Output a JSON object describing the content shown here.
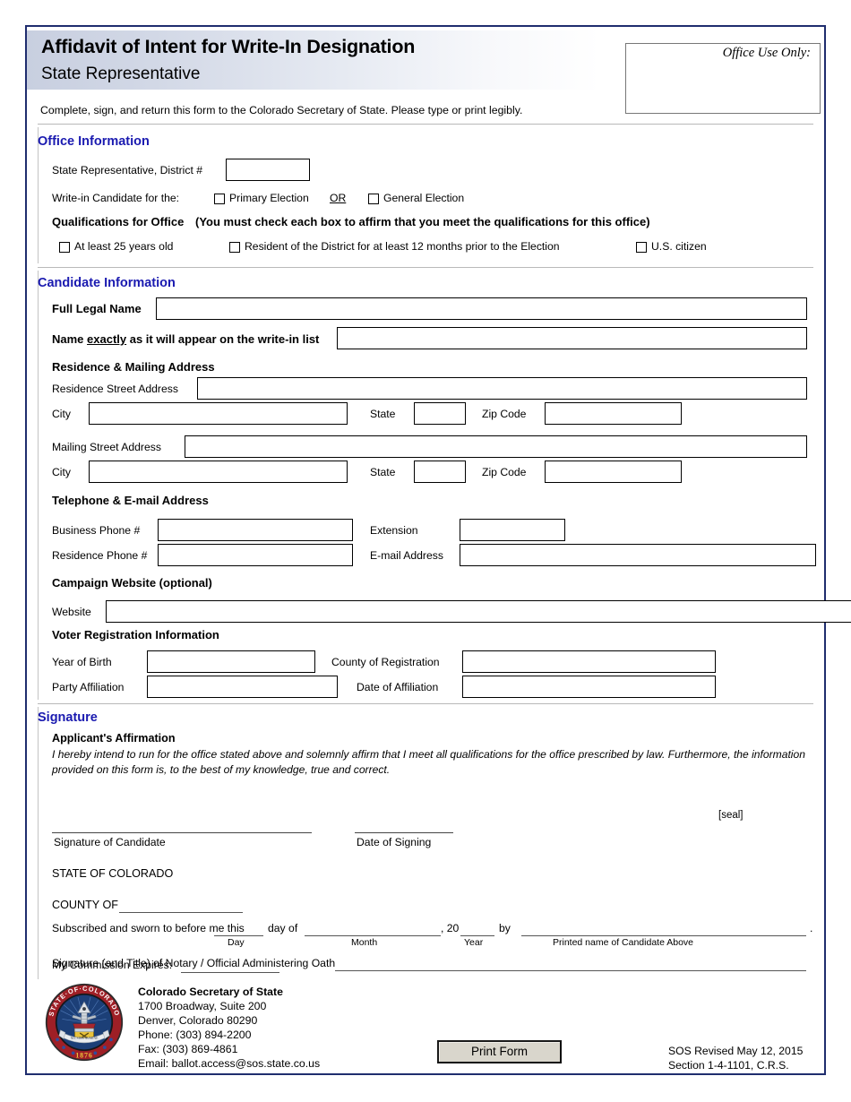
{
  "header": {
    "title": "Affidavit of Intent for Write-In Designation",
    "subtitle": "State Representative",
    "instructions": "Complete, sign, and return this form to the Colorado Secretary of State. Please type or print legibly.",
    "office_use_label": "Office Use Only:"
  },
  "office_information": {
    "heading": "Office Information",
    "district_label": "State Representative, District #",
    "district_value": "",
    "writein_label": "Write-in Candidate for the:",
    "primary_election": "Primary Election",
    "or_label": "OR",
    "general_election": "General Election",
    "qualifications_bold": "Qualifications for Office",
    "qualifications_paren": "(You must check each box to affirm that you meet the qualifications for this office)",
    "qual_age": "At least 25 years old",
    "qual_residency": "Resident of the District for at least 12 months prior to the Election",
    "qual_citizen": "U.S. citizen"
  },
  "candidate_information": {
    "heading": "Candidate Information",
    "full_legal_name_label": "Full Legal Name",
    "full_legal_name_value": "",
    "writein_name_label_1": "Name ",
    "writein_name_label_em": "exactly",
    "writein_name_label_2": " as it will appear on the write-in list",
    "writein_name_value": "",
    "address_heading": "Residence & Mailing Address",
    "residence_street_label": "Residence Street Address",
    "residence_street_value": "",
    "residence_city_label": "City",
    "residence_city_value": "",
    "residence_state_label": "State",
    "residence_state_value": "",
    "residence_zip_label": "Zip Code",
    "residence_zip_value": "",
    "mailing_street_label": "Mailing Street Address",
    "mailing_street_value": "",
    "mailing_city_label": "City",
    "mailing_city_value": "",
    "mailing_state_label": "State",
    "mailing_state_value": "",
    "mailing_zip_label": "Zip Code",
    "mailing_zip_value": "",
    "phone_heading": "Telephone & E-mail Address",
    "business_phone_label": "Business Phone #",
    "business_phone_value": "",
    "extension_label": "Extension",
    "extension_value": "",
    "residence_phone_label": "Residence Phone #",
    "residence_phone_value": "",
    "email_label": "E-mail Address",
    "email_value": "",
    "website_heading": "Campaign Website (optional)",
    "website_label": "Website",
    "website_value": "",
    "voter_heading": "Voter Registration Information",
    "year_of_birth_label": "Year of Birth",
    "year_of_birth_value": "",
    "county_label": "County of Registration",
    "county_value": "",
    "party_label": "Party Affiliation",
    "party_value": "",
    "date_affiliation_label": "Date of Affiliation",
    "date_affiliation_value": ""
  },
  "signature": {
    "heading": "Signature",
    "affirmation_heading": "Applicant's Affirmation",
    "affirmation_text": "I hereby intend to run for the office stated above and solemnly affirm that I meet all qualifications for the office prescribed by law. Furthermore, the information provided on this form is, to the best of my knowledge, true and correct.",
    "seal_marker": "[seal]",
    "signature_of_candidate": "Signature of Candidate",
    "date_of_signing": "Date of Signing",
    "state_of_colorado": "STATE OF COLORADO",
    "county_of": "COUNTY OF",
    "sworn_prefix": "Subscribed and sworn to before me this",
    "sworn_day_of": "day of",
    "sworn_comma20": ", 20",
    "sworn_by": "by",
    "sworn_period": ".",
    "day_label": "Day",
    "month_label": "Month",
    "year_label": "Year",
    "printed_name_label": "Printed name of Candidate Above",
    "notary_signature_label": "Signature (and Title) of Notary / Official Administering Oath",
    "commission_expires_label": "My Commission Expires:"
  },
  "footer": {
    "org": "Colorado Secretary of State",
    "address1": "1700 Broadway, Suite 200",
    "address2": "Denver, Colorado 80290",
    "phone": "Phone: (303) 894-2200",
    "fax": "Fax: (303) 869-4861",
    "email": "Email: ballot.access@sos.state.co.us",
    "print_button": "Print Form",
    "revised": "SOS Revised May 12, 2015",
    "statute": "Section 1-4-1101, C.R.S.",
    "seal_outer_text": "STATE OF COLORADO",
    "seal_year": "1876"
  },
  "colors": {
    "border_navy": "#1f2d6e",
    "heading_blue": "#1a1ab0",
    "header_band": "#c8cfe0",
    "seal_red": "#9e1f26",
    "seal_blue": "#1c3f77",
    "button_face": "#d9d6cc"
  }
}
